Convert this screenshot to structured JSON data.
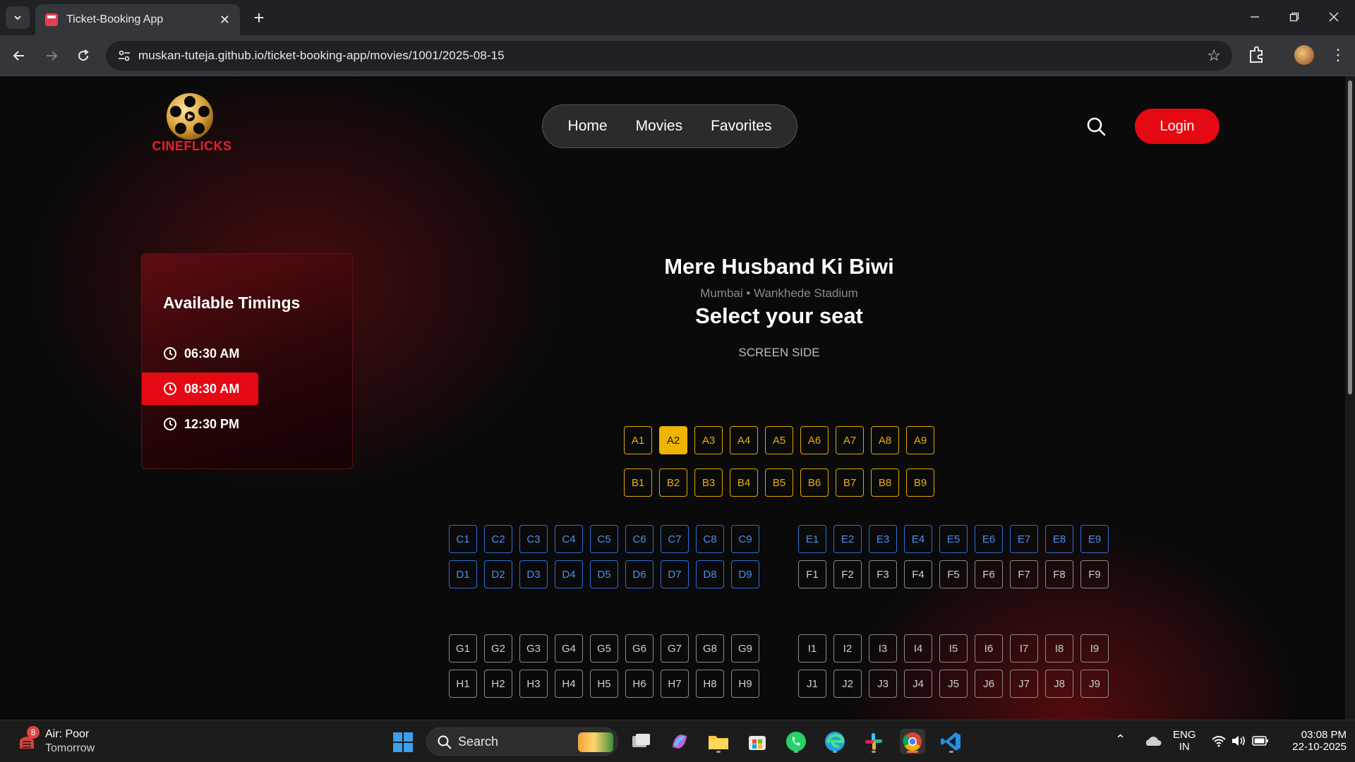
{
  "browser": {
    "tab_title": "Ticket-Booking App",
    "url": "muskan-tuteja.github.io/ticket-booking-app/movies/1001/2025-08-15",
    "icons": [
      "tab-search-icon",
      "close-icon",
      "plus-icon",
      "minimize-icon",
      "restore-icon",
      "window-close-icon",
      "back-icon",
      "forward-icon",
      "reload-icon",
      "site-info-icon",
      "star-icon",
      "extensions-icon",
      "profile-avatar",
      "menu-icon"
    ]
  },
  "header": {
    "logo_text": "CINEFLICKS",
    "nav": [
      "Home",
      "Movies",
      "Favorites"
    ],
    "login_label": "Login",
    "accent": "#e50914"
  },
  "timings": {
    "heading": "Available Timings",
    "items": [
      {
        "label": "06:30 AM",
        "active": false
      },
      {
        "label": "08:30 AM",
        "active": true
      },
      {
        "label": "12:30 PM",
        "active": false
      }
    ]
  },
  "movie": {
    "title": "Mere Husband Ki Biwi",
    "venue": "Mumbai • Wankhede Stadium",
    "select_heading": "Select your seat",
    "screen_label": "SCREEN SIDE"
  },
  "seats": {
    "selected": "A2",
    "colors": {
      "gold": "#e0a800",
      "blue": "#2d6fd6",
      "grey": "#8a8a8a"
    },
    "blocks": [
      {
        "rows": [
          "A",
          "B"
        ],
        "tier": "gold",
        "side": "center"
      },
      {
        "rows": [
          "C",
          "D"
        ],
        "tier": "blue",
        "side": "left"
      },
      {
        "rows": [
          "E"
        ],
        "tier": "blue",
        "side": "right"
      },
      {
        "rows": [
          "F"
        ],
        "tier": "grey",
        "side": "right"
      },
      {
        "rows": [
          "G",
          "H"
        ],
        "tier": "grey",
        "side": "left"
      },
      {
        "rows": [
          "I",
          "J"
        ],
        "tier": "grey",
        "side": "right"
      }
    ],
    "numbers": [
      1,
      2,
      3,
      4,
      5,
      6,
      7,
      8,
      9
    ]
  },
  "taskbar": {
    "weather_badge": "8",
    "weather_line1": "Air: Poor",
    "weather_line2": "Tomorrow",
    "search_label": "Search",
    "lang_line1": "ENG",
    "lang_line2": "IN",
    "time": "03:08 PM",
    "date": "22-10-2025"
  }
}
